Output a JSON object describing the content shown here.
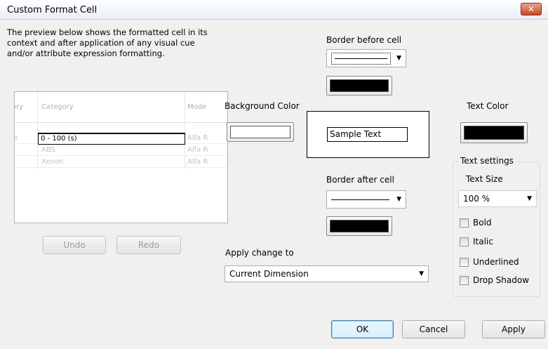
{
  "window": {
    "title": "Custom Format Cell",
    "close_label": "✕"
  },
  "description": "The preview below shows the formatted cell in its context and after application of any visual cue and/or attribute expression formatting.",
  "preview_grid": {
    "headers": [
      "ory",
      "Category",
      "Mode"
    ],
    "selected_cell": "0 - 100 (s)",
    "rows": [
      {
        "left": "e",
        "category": "0 - 100 (s)",
        "model": "Alfa R"
      },
      {
        "left": "",
        "category": "ABS",
        "model": "Alfa R"
      },
      {
        "left": "",
        "category": "Xenon",
        "model": "Alfa R"
      }
    ]
  },
  "history_buttons": {
    "undo": "Undo",
    "redo": "Redo"
  },
  "border_before": {
    "label": "Border before cell"
  },
  "border_after": {
    "label": "Border after cell"
  },
  "background_color": {
    "label": "Background Color",
    "value": "#ffffff"
  },
  "text_color": {
    "label": "Text Color",
    "value": "#000000"
  },
  "border_colors": {
    "before": "#000000",
    "after": "#000000"
  },
  "sample_text": "Sample Text",
  "apply_change": {
    "label": "Apply change to",
    "selected": "Current Dimension"
  },
  "text_settings": {
    "legend": "Text settings",
    "size_label": "Text Size",
    "size_value": "100 %",
    "options": {
      "bold": "Bold",
      "italic": "Italic",
      "underlined": "Underlined",
      "drop_shadow": "Drop Shadow"
    }
  },
  "actions": {
    "ok": "OK",
    "cancel": "Cancel",
    "apply": "Apply"
  },
  "icons": {
    "dropdown": "chevron-down-icon",
    "close": "close-icon"
  }
}
